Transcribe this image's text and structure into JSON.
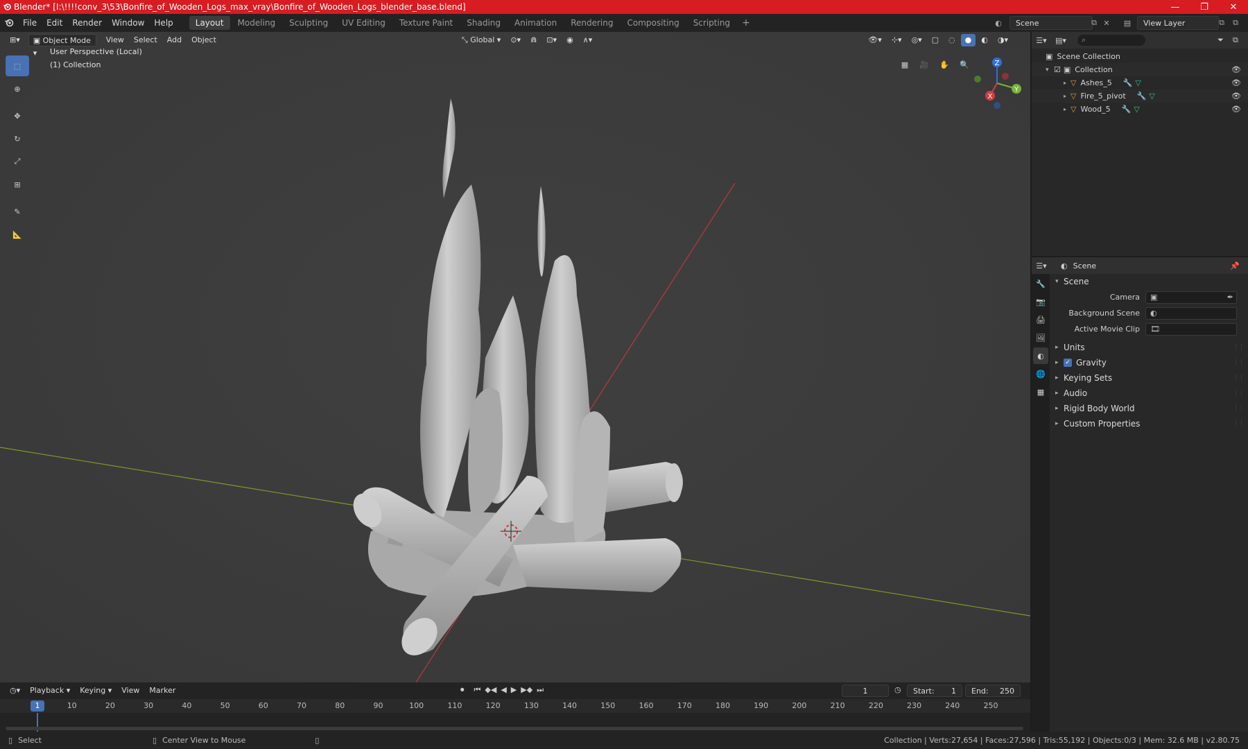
{
  "window": {
    "title": "Blender* [I:\\!!!!conv_3\\53\\Bonfire_of_Wooden_Logs_max_vray\\Bonfire_of_Wooden_Logs_blender_base.blend]",
    "minimize": "—",
    "maximize": "❐",
    "close": "✕"
  },
  "menubar": {
    "items": [
      "File",
      "Edit",
      "Render",
      "Window",
      "Help"
    ]
  },
  "workspaces": {
    "tabs": [
      "Layout",
      "Modeling",
      "Sculpting",
      "UV Editing",
      "Texture Paint",
      "Shading",
      "Animation",
      "Rendering",
      "Compositing",
      "Scripting"
    ],
    "active": "Layout",
    "add": "+"
  },
  "scene_selector": {
    "value": "Scene"
  },
  "view_layer_selector": {
    "value": "View Layer"
  },
  "viewport": {
    "mode": "Object Mode",
    "menus": [
      "View",
      "Select",
      "Add",
      "Object"
    ],
    "transform_orientation": "Global",
    "perspective_label": "User Perspective (Local)",
    "collection_label": "(1) Collection",
    "gizmo": {
      "x": "X",
      "y": "Y",
      "z": "Z"
    }
  },
  "outliner": {
    "root": "Scene Collection",
    "collection": "Collection",
    "objects": [
      "Ashes_5",
      "Fire_5_pivot",
      "Wood_5"
    ]
  },
  "properties": {
    "context": "Scene",
    "panel_title": "Scene",
    "fields": [
      {
        "label": "Camera",
        "value": ""
      },
      {
        "label": "Background Scene",
        "value": ""
      },
      {
        "label": "Active Movie Clip",
        "value": ""
      }
    ],
    "subpanels": [
      "Units",
      "Gravity",
      "Keying Sets",
      "Audio",
      "Rigid Body World",
      "Custom Properties"
    ],
    "gravity_checked": true
  },
  "timeline": {
    "menus": [
      "Playback",
      "Keying",
      "View",
      "Marker"
    ],
    "current_frame": "1",
    "start_label": "Start:",
    "start": "1",
    "end_label": "End:",
    "end": "250",
    "ticks": [
      "1",
      "10",
      "20",
      "30",
      "40",
      "50",
      "60",
      "70",
      "80",
      "90",
      "100",
      "110",
      "120",
      "130",
      "140",
      "150",
      "160",
      "170",
      "180",
      "190",
      "200",
      "210",
      "220",
      "230",
      "240",
      "250"
    ]
  },
  "statusbar": {
    "select": "Select",
    "center_view": "Center View to Mouse",
    "stats": "Collection | Verts:27,654 | Faces:27,596 | Tris:55,192 | Objects:0/3 | Mem: 32.6 MB | v2.80.75"
  },
  "colors": {
    "accent": "#4772b3",
    "titlebar": "#d71c22",
    "viewport_bg": "#3a3a3a",
    "axis_x": "#b9383f",
    "axis_y": "#7c9a27",
    "object_orange": "#e8963a"
  }
}
